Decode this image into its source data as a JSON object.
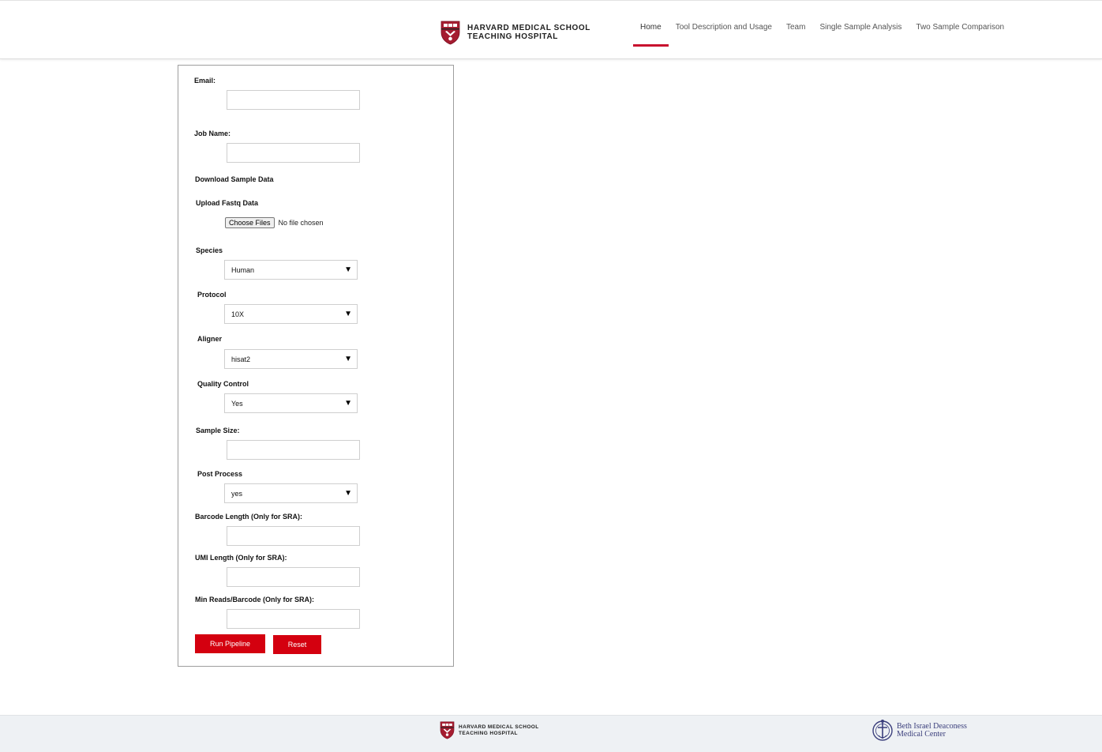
{
  "brand": {
    "line1": "HARVARD MEDICAL SCHOOL",
    "line2": "TEACHING HOSPITAL"
  },
  "nav": [
    {
      "label": "Home",
      "active": true
    },
    {
      "label": "Tool Description and Usage",
      "active": false
    },
    {
      "label": "Team",
      "active": false
    },
    {
      "label": "Single Sample Analysis",
      "active": false
    },
    {
      "label": "Two Sample Comparison",
      "active": false
    }
  ],
  "form": {
    "email_label": "Email:",
    "email_value": "",
    "job_name_label": "Job Name:",
    "job_name_value": "",
    "download_sample_label": "Download Sample Data",
    "upload_label": "Upload Fastq Data",
    "choose_files_label": "Choose Files",
    "file_status": "No file chosen",
    "species_label": "Species",
    "species_value": "Human",
    "protocol_label": "Protocol",
    "protocol_value": "10X",
    "aligner_label": "Aligner",
    "aligner_value": "hisat2",
    "qc_label": "Quality Control",
    "qc_value": "Yes",
    "sample_size_label": "Sample Size:",
    "sample_size_value": "",
    "post_process_label": "Post Process",
    "post_process_value": "yes",
    "barcode_label": "Barcode Length (Only for SRA):",
    "barcode_value": "",
    "umi_label": "UMI Length (Only for SRA):",
    "umi_value": "",
    "min_reads_label": "Min Reads/Barcode (Only for SRA):",
    "min_reads_value": "",
    "run_label": "Run Pipeline",
    "reset_label": "Reset",
    "dropdown_arrow": "▼"
  },
  "footer": {
    "hms_line1": "HARVARD MEDICAL SCHOOL",
    "hms_line2": "TEACHING HOSPITAL",
    "bidmc_line1": "Beth Israel Deaconess",
    "bidmc_line2": "Medical Center"
  },
  "colors": {
    "accent": "#c8102e",
    "button": "#d4000f",
    "bidmc": "#3b3f7c"
  },
  "icons": {
    "hms_logo": "harvard-shield-icon",
    "bidmc_logo": "bidmc-emblem-icon",
    "dropdown": "chevron-down-icon"
  }
}
